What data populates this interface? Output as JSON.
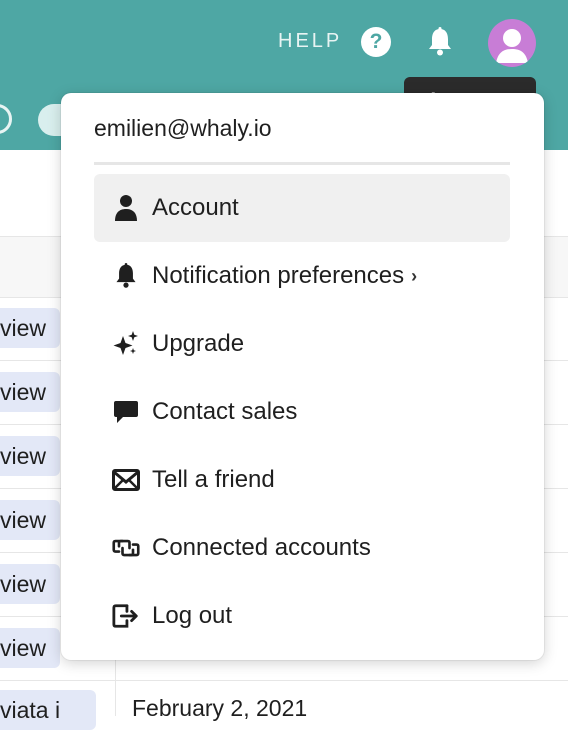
{
  "header": {
    "help_label": "HELP",
    "help_icon": "question-circle-icon",
    "bell_icon": "bell-icon",
    "avatar_icon": "user-avatar-icon",
    "tooltip": "Account",
    "brand_color": "#4ea7a4"
  },
  "background_table": {
    "chip_text": [
      "view",
      "view",
      "view",
      "view",
      "view",
      "view",
      "viata i"
    ],
    "bottom_row_text": "February 2, 2021"
  },
  "dropdown": {
    "email": "emilien@whaly.io",
    "items": [
      {
        "label": "Account",
        "icon": "user-icon",
        "active": true
      },
      {
        "label": "Notification preferences",
        "icon": "bell-icon",
        "submenu": true
      },
      {
        "label": "Upgrade",
        "icon": "sparkles-icon"
      },
      {
        "label": "Contact sales",
        "icon": "chat-bubble-icon"
      },
      {
        "label": "Tell a friend",
        "icon": "envelope-icon"
      },
      {
        "label": "Connected accounts",
        "icon": "link-icon"
      },
      {
        "label": "Log out",
        "icon": "logout-icon"
      }
    ]
  }
}
